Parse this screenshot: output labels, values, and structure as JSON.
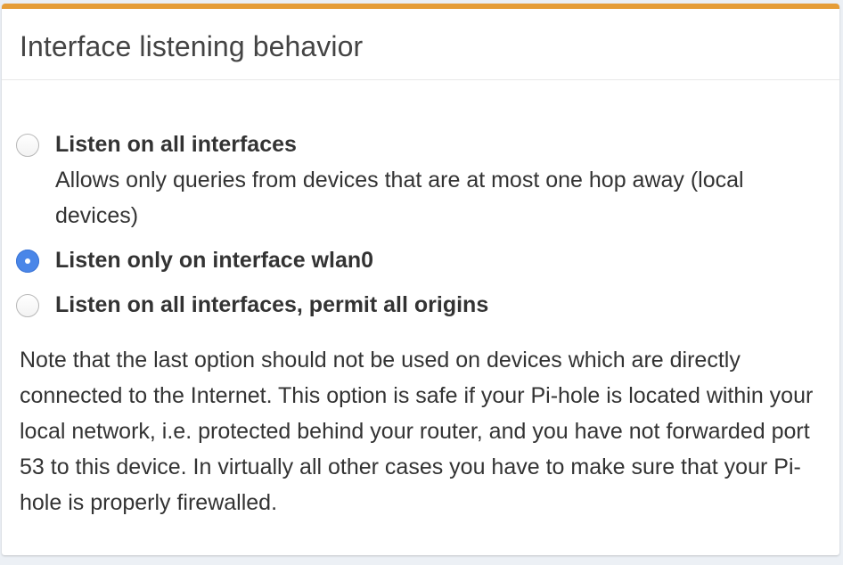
{
  "panel": {
    "title": "Interface listening behavior",
    "accent_color": "#e59d38"
  },
  "options": [
    {
      "label": "Listen on all interfaces",
      "description": "Allows only queries from devices that are at most one hop away (local devices)",
      "checked": false
    },
    {
      "label": "Listen only on interface wlan0",
      "checked": true
    },
    {
      "label": "Listen on all interfaces, permit all origins",
      "checked": false
    }
  ],
  "note": "Note that the last option should not be used on devices which are directly connected to the Internet. This option is safe if your Pi-hole is located within your local network, i.e. protected behind your router, and you have not forwarded port 53 to this device. In virtually all other cases you have to make sure that your Pi-hole is properly firewalled.",
  "colors": {
    "radio_checked": "#4a86e8",
    "text": "#333333"
  }
}
